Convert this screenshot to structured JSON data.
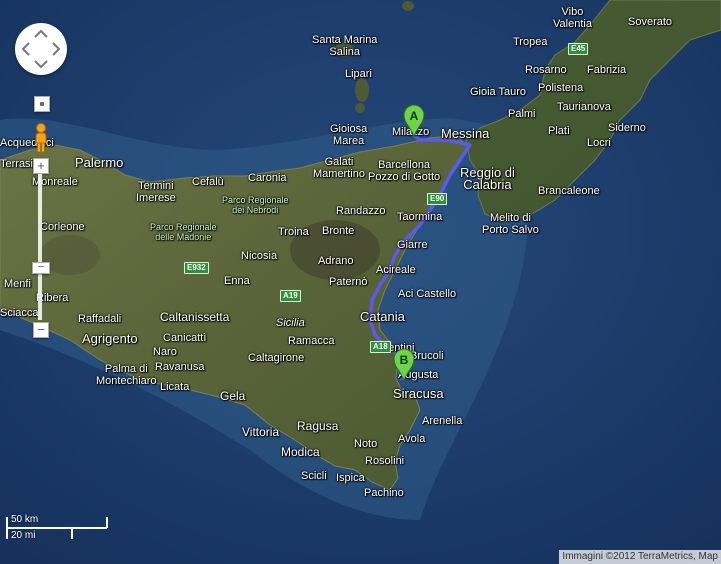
{
  "labels": {
    "vibo_valentia": "Vibo\nValentia",
    "soverato": "Soverato",
    "tropea": "Tropea",
    "santa_marina_salina": "Santa Marina\nSalina",
    "lipari": "Lipari",
    "rosarno": "Rosarno",
    "fabrizia": "Fabrizia",
    "gioia_tauro": "Gioia Tauro",
    "polistena": "Polistena",
    "taurianova": "Taurianova",
    "palmi": "Palmi",
    "plati": "Platì",
    "siderno": "Siderno",
    "locri": "Locri",
    "gioiosa_marea": "Gioiosa\nMarea",
    "milazzo": "Milazzo",
    "messina": "Messina",
    "acquedolci": "Acquedolci",
    "galati_mamertino": "Galati\nMamertino",
    "barcellona": "Barcellona\nPozzo di Gotto",
    "reggio": "Reggio di\nCalabria",
    "brancaleone": "Brancaleone",
    "terrasini": "Terrasini",
    "palermo": "Palermo",
    "monreale": "Monreale",
    "termini": "Termini\nImerese",
    "cefalu": "Cefalù",
    "caronia": "Caronia",
    "parco_nebrodi": "Parco Regionale\ndei Nebrodi",
    "melito": "Melito di\nPorto Salvo",
    "parco_madonie": "Parco Regionale\ndelle Madonie",
    "randazzo": "Randazzo",
    "taormina": "Taormina",
    "corleone": "Corleone",
    "troina": "Troina",
    "bronte": "Bronte",
    "giarre": "Giarre",
    "nicosia": "Nicosia",
    "adrano": "Adrano",
    "acireale": "Acireale",
    "enna": "Enna",
    "paterno": "Paternò",
    "aci_castello": "Aci Castello",
    "menfi": "Menfi",
    "ribera": "Ribera",
    "sciacca": "Sciacca",
    "raffadali": "Raffadali",
    "caltanissetta": "Caltanissetta",
    "catania": "Catania",
    "sicilia": "Sicilia",
    "agrigento": "Agrigento",
    "canicatti": "Canicattì",
    "ramacca": "Ramacca",
    "naro": "Naro",
    "lentini": "Lentini",
    "brucoli": "Brucoli",
    "ravanusa": "Ravanusa",
    "caltagirone": "Caltagirone",
    "augusta": "Augusta",
    "palma": "Palma di\nMontechiaro",
    "licata": "Licata",
    "siracusa": "Siracusa",
    "gela": "Gela",
    "arenella": "Arenella",
    "vittoria": "Vittoria",
    "ragusa": "Ragusa",
    "noto": "Noto",
    "avola": "Avola",
    "modica": "Modica",
    "rosolini": "Rosolini",
    "scicli": "Scicli",
    "ispica": "Ispica",
    "pachino": "Pachino"
  },
  "road_shields": {
    "e45": "E45",
    "e90": "E90",
    "e932": "E932",
    "a19": "A19",
    "a18": "A18",
    "e45b": "E45"
  },
  "markers": {
    "a": "A",
    "b": "B"
  },
  "controls": {
    "zoom_in": "+",
    "zoom_out": "−",
    "zoom_out_bottom": "−"
  },
  "scale": {
    "km": "50 km",
    "mi": "20 mi"
  },
  "copyright": "Immagini ©2012 TerraMetrics, Map",
  "colors": {
    "sea": "#1d3d6b",
    "land": "#5d6a3c",
    "route": "#5a5aff",
    "marker": "#6fd24a"
  }
}
